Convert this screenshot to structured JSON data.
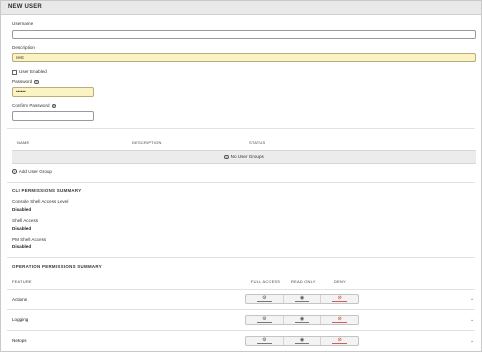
{
  "header": {
    "title": "NEW USER"
  },
  "form": {
    "username_label": "Username",
    "username_value": "",
    "description_label": "Description",
    "description_value": "rest",
    "user_enabled_label": "User Enabled",
    "password_label": "Password",
    "password_value": "••••••",
    "confirm_password_label": "Confirm Password",
    "confirm_password_value": ""
  },
  "groups_table": {
    "columns": [
      "NAME",
      "DESCRIPTION",
      "STATUS"
    ],
    "empty_text": "No User Groups",
    "add_label": "Add User Group"
  },
  "cli": {
    "title": "CLI PERMISSIONS SUMMARY",
    "items": [
      {
        "label": "Console Shell Access Level",
        "value": "Disabled"
      },
      {
        "label": "Shell Access",
        "value": "Disabled"
      },
      {
        "label": "PM Shell Access",
        "value": "Disabled"
      }
    ]
  },
  "operation": {
    "title": "OPERATION PERMISSIONS SUMMARY",
    "columns": {
      "feature": "FEATURE",
      "full": "FULL ACCESS",
      "read": "READ ONLY",
      "deny": "DENY"
    },
    "rows": [
      {
        "label": "Actions"
      },
      {
        "label": "Logging"
      },
      {
        "label": "Netops"
      }
    ]
  },
  "icons": {
    "full_access": "settings-icon",
    "read_only": "eye-icon",
    "deny": "block-icon",
    "expand": "chevron-down-icon"
  },
  "colors": {
    "highlight": "#fbf3c3",
    "deny": "#c0392b"
  }
}
